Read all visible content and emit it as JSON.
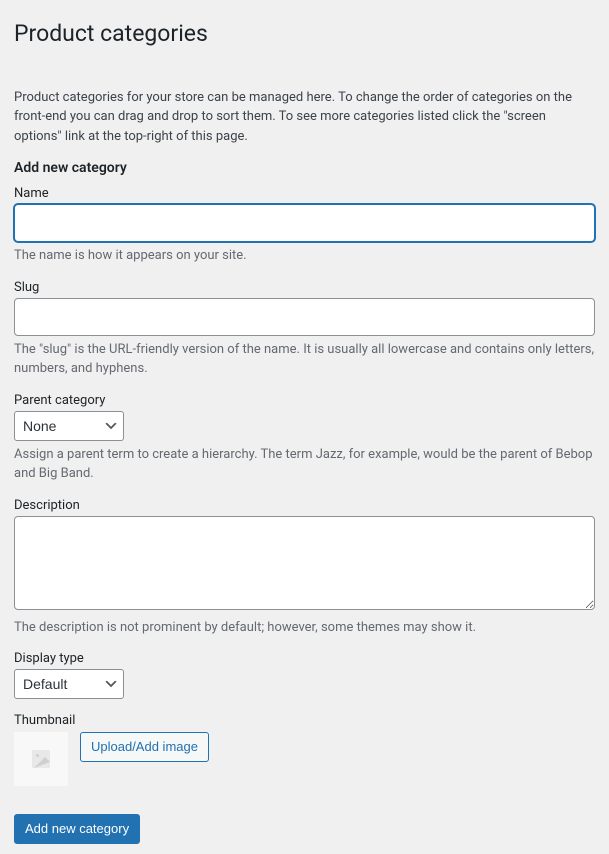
{
  "page_title": "Product categories",
  "intro_text": "Product categories for your store can be managed here. To change the order of categories on the front-end you can drag and drop to sort them. To see more categories listed click the \"screen options\" link at the top-right of this page.",
  "form_heading": "Add new category",
  "fields": {
    "name": {
      "label": "Name",
      "value": "",
      "help": "The name is how it appears on your site."
    },
    "slug": {
      "label": "Slug",
      "value": "",
      "help": "The \"slug\" is the URL-friendly version of the name. It is usually all lowercase and contains only letters, numbers, and hyphens."
    },
    "parent": {
      "label": "Parent category",
      "selected": "None",
      "help": "Assign a parent term to create a hierarchy. The term Jazz, for example, would be the parent of Bebop and Big Band."
    },
    "description": {
      "label": "Description",
      "value": "",
      "help": "The description is not prominent by default; however, some themes may show it."
    },
    "display_type": {
      "label": "Display type",
      "selected": "Default"
    },
    "thumbnail": {
      "label": "Thumbnail",
      "upload_button": "Upload/Add image"
    }
  },
  "submit_button": "Add new category"
}
